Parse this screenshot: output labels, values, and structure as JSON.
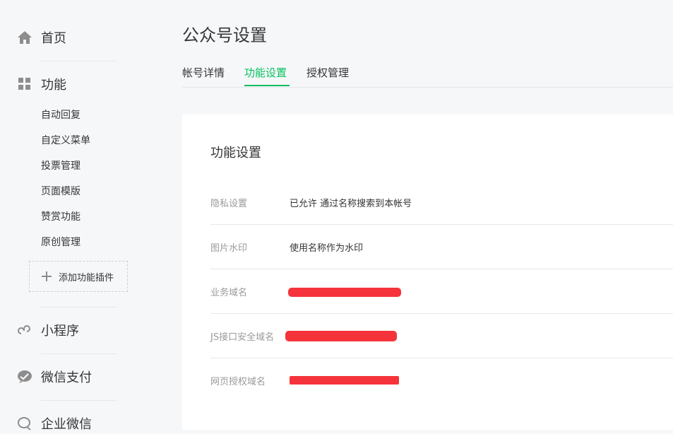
{
  "sidebar": {
    "home": "首页",
    "features": "功能",
    "feature_items": [
      "自动回复",
      "自定义菜单",
      "投票管理",
      "页面模版",
      "赞赏功能",
      "原创管理"
    ],
    "add_plugin": "添加功能插件",
    "mini_program": "小程序",
    "wechat_pay": "微信支付",
    "wecom": "企业微信"
  },
  "page": {
    "title": "公众号设置"
  },
  "tabs": [
    "帐号详情",
    "功能设置",
    "授权管理"
  ],
  "active_tab": "功能设置",
  "card": {
    "title": "功能设置",
    "rows": [
      {
        "label": "隐私设置",
        "value": "已允许 通过名称搜索到本帐号"
      },
      {
        "label": "图片水印",
        "value": "使用名称作为水印"
      },
      {
        "label": "业务域名",
        "value": ""
      },
      {
        "label": "JS接口安全域名",
        "value": ""
      },
      {
        "label": "网页授权域名",
        "value": ""
      }
    ]
  },
  "colors": {
    "accent": "#07c160",
    "redaction": "#f5333a"
  }
}
